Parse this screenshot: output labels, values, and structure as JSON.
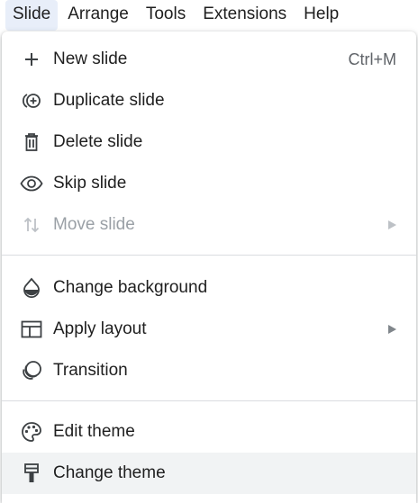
{
  "menubar": {
    "items": [
      {
        "label": "Slide",
        "active": true
      },
      {
        "label": "Arrange"
      },
      {
        "label": "Tools"
      },
      {
        "label": "Extensions"
      },
      {
        "label": "Help"
      }
    ]
  },
  "dropdown": {
    "sections": [
      {
        "items": [
          {
            "label": "New slide",
            "icon": "plus-icon",
            "shortcut": "Ctrl+M"
          },
          {
            "label": "Duplicate slide",
            "icon": "duplicate-slide-icon"
          },
          {
            "label": "Delete slide",
            "icon": "trash-icon"
          },
          {
            "label": "Skip slide",
            "icon": "eye-icon"
          },
          {
            "label": "Move slide",
            "icon": "move-arrows-icon",
            "disabled": true,
            "submenu": true
          }
        ]
      },
      {
        "items": [
          {
            "label": "Change background",
            "icon": "background-drop-icon"
          },
          {
            "label": "Apply layout",
            "icon": "layout-icon",
            "submenu": true
          },
          {
            "label": "Transition",
            "icon": "transition-icon"
          }
        ]
      },
      {
        "items": [
          {
            "label": "Edit theme",
            "icon": "palette-icon"
          },
          {
            "label": "Change theme",
            "icon": "paint-roller-icon",
            "hovered": true
          }
        ]
      }
    ]
  },
  "colors": {
    "menu_text": "#1f1f1f",
    "disabled_text": "#9aa0a6",
    "active_menubar_bg": "#e8eef9",
    "hover_bg": "#f1f3f4",
    "divider": "#dadce0"
  }
}
